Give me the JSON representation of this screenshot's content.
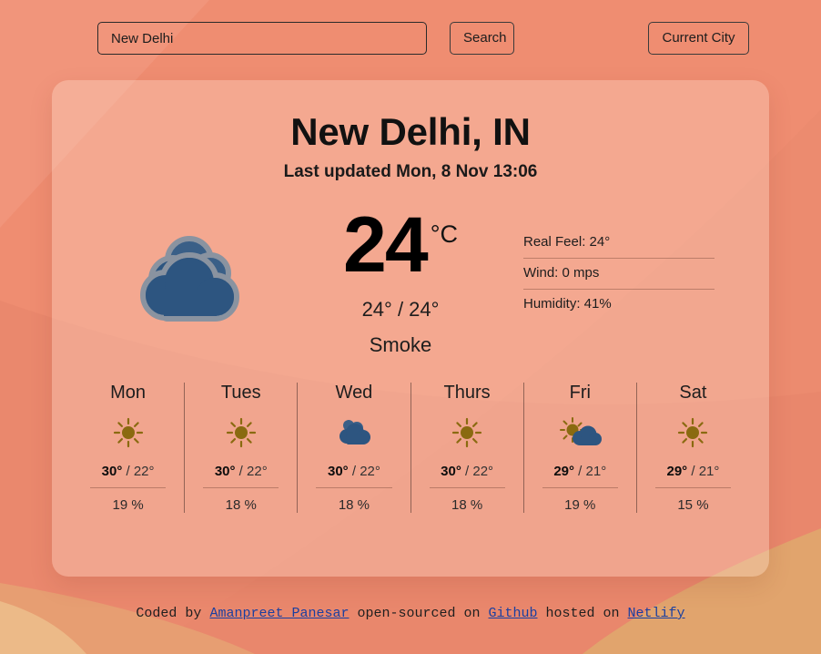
{
  "theme": {
    "background": "#ef8d71",
    "background_shape_light": "#f2a088",
    "background_shape_dark": "#e8836a",
    "background_shape_sand": "#e0a56e",
    "card_overlay": "rgba(255,226,210,0.32)",
    "cloud_color": "#2d5580",
    "cloud_outline": "#8a93a0",
    "sun_color": "#8a6a10",
    "link_color": "#1a3fa0"
  },
  "search": {
    "input_value": "New Delhi",
    "input_placeholder": "Enter a city..",
    "search_label": "Search",
    "current_city_label": "Current City"
  },
  "current": {
    "city": "New Delhi, IN",
    "last_updated": "Last updated Mon, 8 Nov 13:06",
    "icon": "cloud-icon",
    "temperature": "24",
    "unit": "°C",
    "min_max": "24° / 24°",
    "description": "Smoke",
    "details": [
      {
        "label": "Real Feel: 24°"
      },
      {
        "label": "Wind: 0 mps"
      },
      {
        "label": "Humidity: 41%"
      }
    ]
  },
  "forecast": [
    {
      "day": "Mon",
      "icon": "sun-icon",
      "high": "30°",
      "sep": " / ",
      "low": "22°",
      "pop": "19 %"
    },
    {
      "day": "Tues",
      "icon": "sun-icon",
      "high": "30°",
      "sep": " / ",
      "low": "22°",
      "pop": "18 %"
    },
    {
      "day": "Wed",
      "icon": "cloud-icon",
      "high": "30°",
      "sep": " / ",
      "low": "22°",
      "pop": "18 %"
    },
    {
      "day": "Thurs",
      "icon": "sun-icon",
      "high": "30°",
      "sep": " / ",
      "low": "22°",
      "pop": "18 %"
    },
    {
      "day": "Fri",
      "icon": "sun-behind-cloud-icon",
      "high": "29°",
      "sep": " / ",
      "low": "21°",
      "pop": "19 %"
    },
    {
      "day": "Sat",
      "icon": "sun-icon",
      "high": "29°",
      "sep": " / ",
      "low": "21°",
      "pop": "15 %"
    }
  ],
  "footer": {
    "prefix": "Coded by ",
    "author": "Amanpreet Panesar",
    "middle": " open-sourced on ",
    "source_link": "Github",
    "hosted": " hosted on ",
    "host_link": "Netlify"
  }
}
